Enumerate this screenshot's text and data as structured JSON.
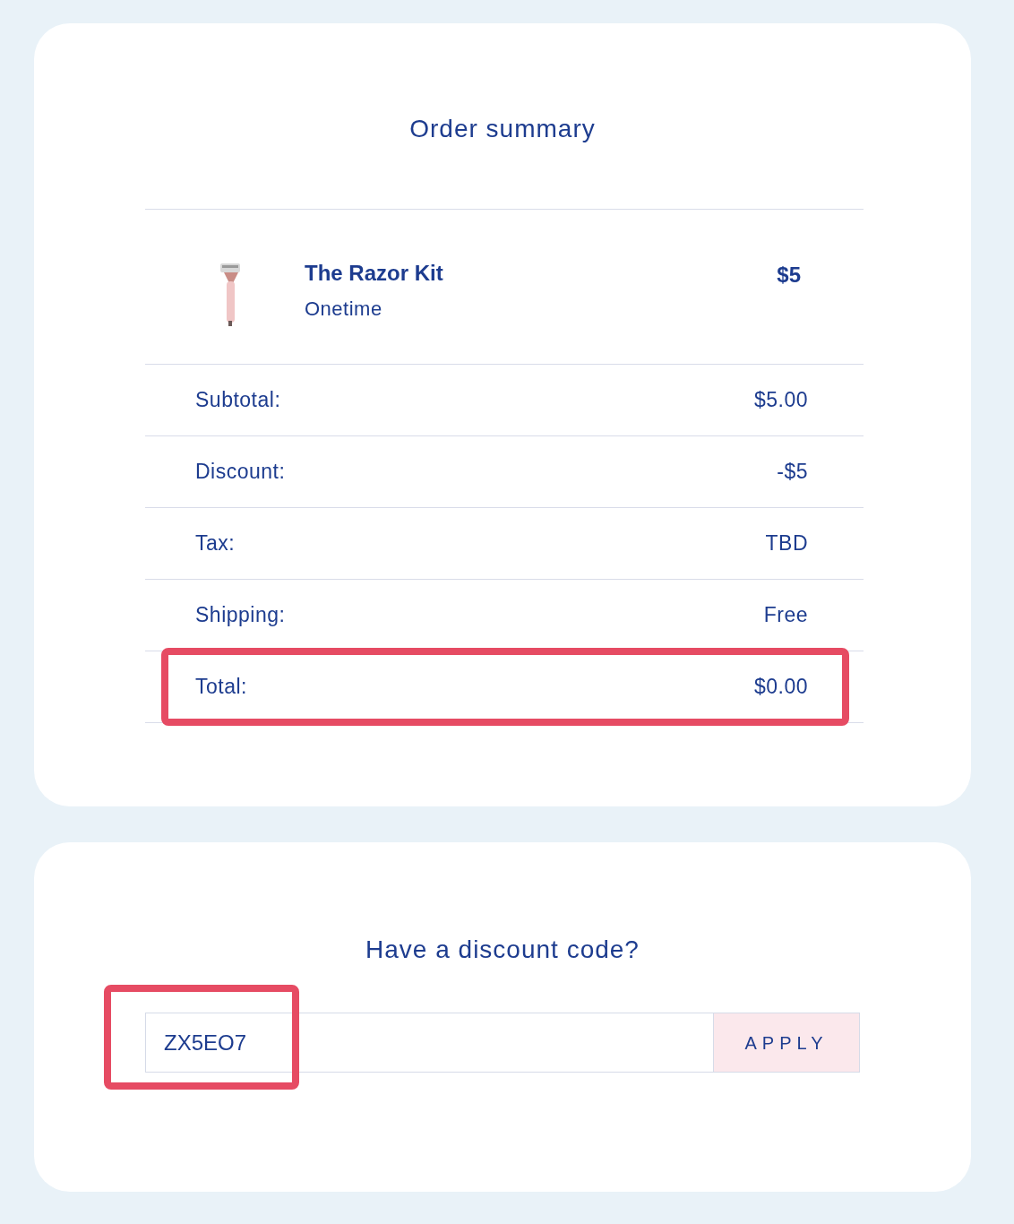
{
  "summary": {
    "title": "Order summary",
    "item": {
      "name": "The Razor Kit",
      "plan": "Onetime",
      "price": "$5"
    },
    "rows": [
      {
        "label": "Subtotal:",
        "value": "$5.00",
        "highlighted": false
      },
      {
        "label": "Discount:",
        "value": "-$5",
        "highlighted": false
      },
      {
        "label": "Tax:",
        "value": "TBD",
        "highlighted": false
      },
      {
        "label": "Shipping:",
        "value": "Free",
        "highlighted": false
      },
      {
        "label": "Total:",
        "value": "$0.00",
        "highlighted": true
      }
    ]
  },
  "discount": {
    "title": "Have a discount code?",
    "code": "ZX5EO7",
    "code_highlighted": true,
    "button": "APPLY"
  }
}
